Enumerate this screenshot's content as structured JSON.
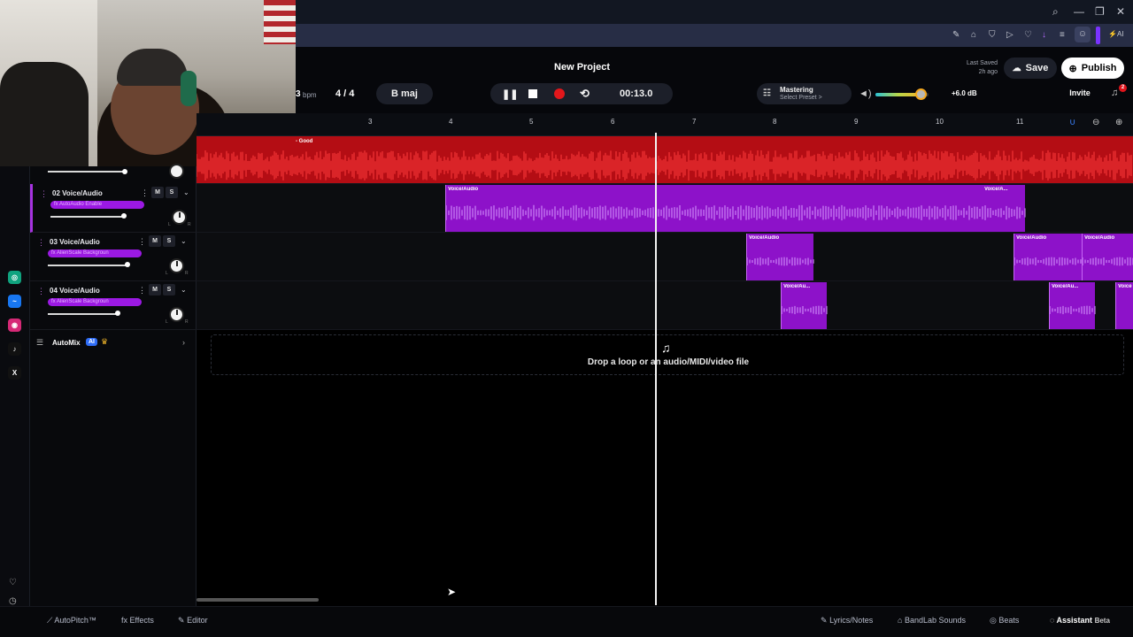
{
  "window": {
    "search_icon": "search-icon",
    "min": "—",
    "restore": "❐",
    "close": "✕"
  },
  "browser": {
    "icons": [
      "✎",
      "⌂",
      "⛉",
      "▷",
      "♡",
      "↓",
      "≡",
      "☺"
    ],
    "ai_label": "AI"
  },
  "header": {
    "project_title": "New Project",
    "bpm_value": "3",
    "bpm_unit": "bpm",
    "time_signature": "4 / 4",
    "key": "B maj",
    "time_display": "00:13.0",
    "mastering_title": "Mastering",
    "mastering_sub": "Select Preset >",
    "volume_db": "+6.0 dB",
    "volume_level": 0.85,
    "last_saved_label": "Last Saved",
    "last_saved_time": "2h ago",
    "save_label": "Save",
    "publish_label": "Publish",
    "invite_label": "Invite",
    "notification_count": "2"
  },
  "ruler": {
    "marks": [
      "3",
      "4",
      "5",
      "6",
      "7",
      "8",
      "9",
      "10",
      "11"
    ]
  },
  "tracks": [
    {
      "number": "02",
      "name": "Voice/Audio",
      "fx": "fx AutoAudio Enable",
      "volume": 0.65,
      "mute": "M",
      "solo": "S"
    },
    {
      "number": "03",
      "name": "Voice/Audio",
      "fx": "fx AlienScale Backgroun",
      "volume": 0.7,
      "mute": "M",
      "solo": "S"
    },
    {
      "number": "04",
      "name": "Voice/Audio",
      "fx": "fx AlienScale Backgroun",
      "volume": 0.62,
      "mute": "M",
      "solo": "S"
    }
  ],
  "top_clip_label": "- Good",
  "clips": {
    "track2": [
      {
        "label": "Voice/Audio"
      },
      {
        "label": "Voice/A..."
      }
    ],
    "track3": [
      {
        "label": "Voice/Audio"
      },
      {
        "label": "Voice/Audio"
      },
      {
        "label": "Voice/Audio"
      }
    ],
    "track4": [
      {
        "label": "Voice/Au..."
      },
      {
        "label": "Voice/Au..."
      },
      {
        "label": "Voice"
      }
    ]
  },
  "automix": {
    "label": "AutoMix",
    "badge": "AI"
  },
  "drop_zone": {
    "text": "Drop a loop or an audio/MIDI/video file"
  },
  "bottom": {
    "autopitch": "AutoPitch™",
    "effects": "Effects",
    "editor": "Editor",
    "lyrics": "Lyrics/Notes",
    "sounds": "BandLab Sounds",
    "beats": "Beats",
    "assistant": "Assistant",
    "beta": "Beta"
  },
  "colors": {
    "accent_red": "#e0141b",
    "clip_purple": "#8d12c9",
    "fx_purple": "#9b19e3",
    "record": "#e3171b"
  }
}
